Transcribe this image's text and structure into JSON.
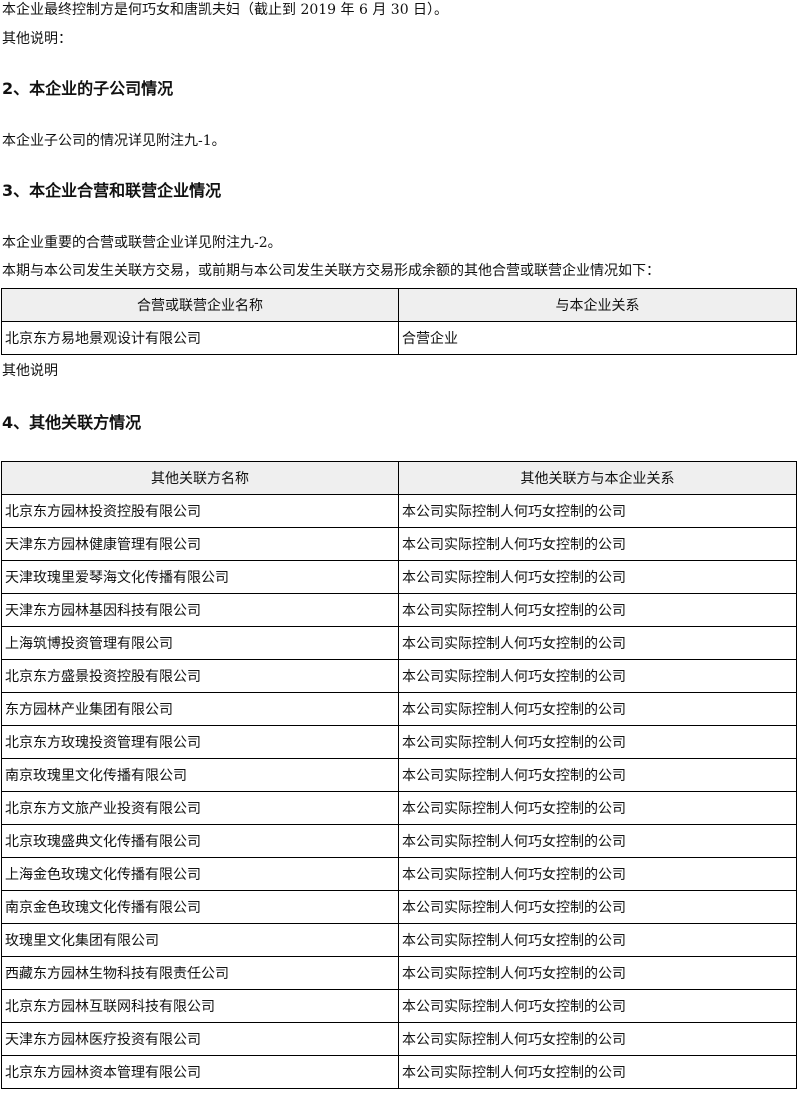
{
  "intro": {
    "controller_line": "本企业最终控制方是何巧女和唐凯夫妇（截止到 2019 年 6 月 30 日）。",
    "other_note": "其他说明："
  },
  "section2": {
    "heading": "2、本企业的子公司情况",
    "text": "本企业子公司的情况详见附注九-1。"
  },
  "section3": {
    "heading": "3、本企业合营和联营企业情况",
    "text1": "本企业重要的合营或联营企业详见附注九-2。",
    "text2": "本期与本公司发生关联方交易，或前期与本公司发生关联方交易形成余额的其他合营或联营企业情况如下：",
    "table": {
      "headers": [
        "合营或联营企业名称",
        "与本企业关系"
      ],
      "rows": [
        [
          "北京东方易地景观设计有限公司",
          "合营企业"
        ]
      ]
    },
    "note": "其他说明"
  },
  "section4": {
    "heading": "4、其他关联方情况",
    "table": {
      "headers": [
        "其他关联方名称",
        "其他关联方与本企业关系"
      ],
      "rows": [
        [
          "北京东方园林投资控股有限公司",
          "本公司实际控制人何巧女控制的公司"
        ],
        [
          "天津东方园林健康管理有限公司",
          "本公司实际控制人何巧女控制的公司"
        ],
        [
          "天津玫瑰里爱琴海文化传播有限公司",
          "本公司实际控制人何巧女控制的公司"
        ],
        [
          "天津东方园林基因科技有限公司",
          "本公司实际控制人何巧女控制的公司"
        ],
        [
          "上海筑博投资管理有限公司",
          "本公司实际控制人何巧女控制的公司"
        ],
        [
          "北京东方盛景投资控股有限公司",
          "本公司实际控制人何巧女控制的公司"
        ],
        [
          "东方园林产业集团有限公司",
          "本公司实际控制人何巧女控制的公司"
        ],
        [
          "北京东方玫瑰投资管理有限公司",
          "本公司实际控制人何巧女控制的公司"
        ],
        [
          "南京玫瑰里文化传播有限公司",
          "本公司实际控制人何巧女控制的公司"
        ],
        [
          "北京东方文旅产业投资有限公司",
          "本公司实际控制人何巧女控制的公司"
        ],
        [
          "北京玫瑰盛典文化传播有限公司",
          "本公司实际控制人何巧女控制的公司"
        ],
        [
          "上海金色玫瑰文化传播有限公司",
          "本公司实际控制人何巧女控制的公司"
        ],
        [
          "南京金色玫瑰文化传播有限公司",
          "本公司实际控制人何巧女控制的公司"
        ],
        [
          "玫瑰里文化集团有限公司",
          "本公司实际控制人何巧女控制的公司"
        ],
        [
          "西藏东方园林生物科技有限责任公司",
          "本公司实际控制人何巧女控制的公司"
        ],
        [
          "北京东方园林互联网科技有限公司",
          "本公司实际控制人何巧女控制的公司"
        ],
        [
          "天津东方园林医疗投资有限公司",
          "本公司实际控制人何巧女控制的公司"
        ],
        [
          "北京东方园林资本管理有限公司",
          "本公司实际控制人何巧女控制的公司"
        ]
      ]
    }
  }
}
